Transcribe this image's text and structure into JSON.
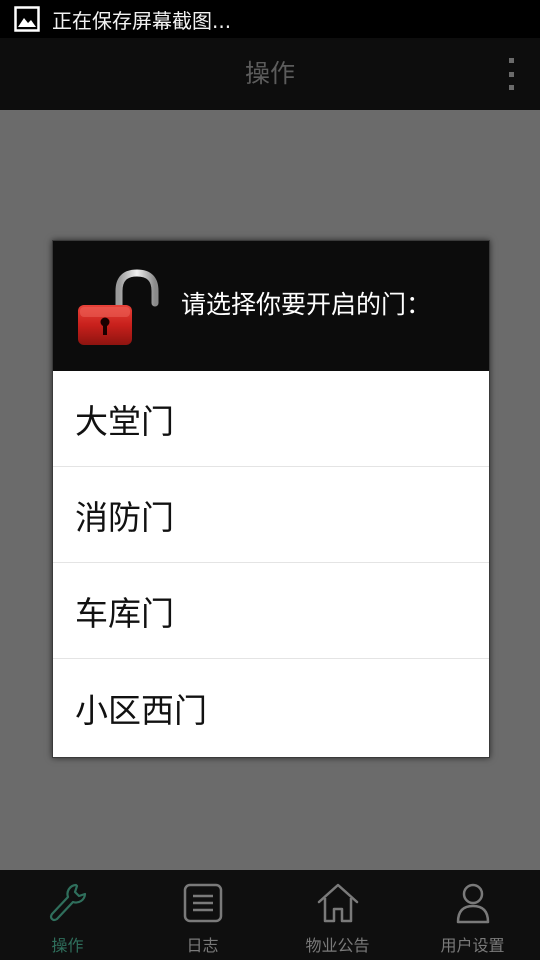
{
  "status_bar": {
    "notification_text": "正在保存屏幕截图..."
  },
  "action_bar": {
    "title": "操作"
  },
  "dialog": {
    "title": "请选择你要开启的门：",
    "doors": [
      {
        "label": "大堂门"
      },
      {
        "label": "消防门"
      },
      {
        "label": "车库门"
      },
      {
        "label": "小区西门"
      }
    ]
  },
  "bottom_nav": {
    "items": [
      {
        "label": "操作",
        "icon": "wrench-icon",
        "active": true
      },
      {
        "label": "日志",
        "icon": "list-icon",
        "active": false
      },
      {
        "label": "物业公告",
        "icon": "home-icon",
        "active": false
      },
      {
        "label": "用户设置",
        "icon": "user-icon",
        "active": false
      }
    ]
  },
  "colors": {
    "active_tab": "#2f6f5c",
    "lock_red": "#c8201c",
    "dim_background": "#6b6b6b"
  }
}
